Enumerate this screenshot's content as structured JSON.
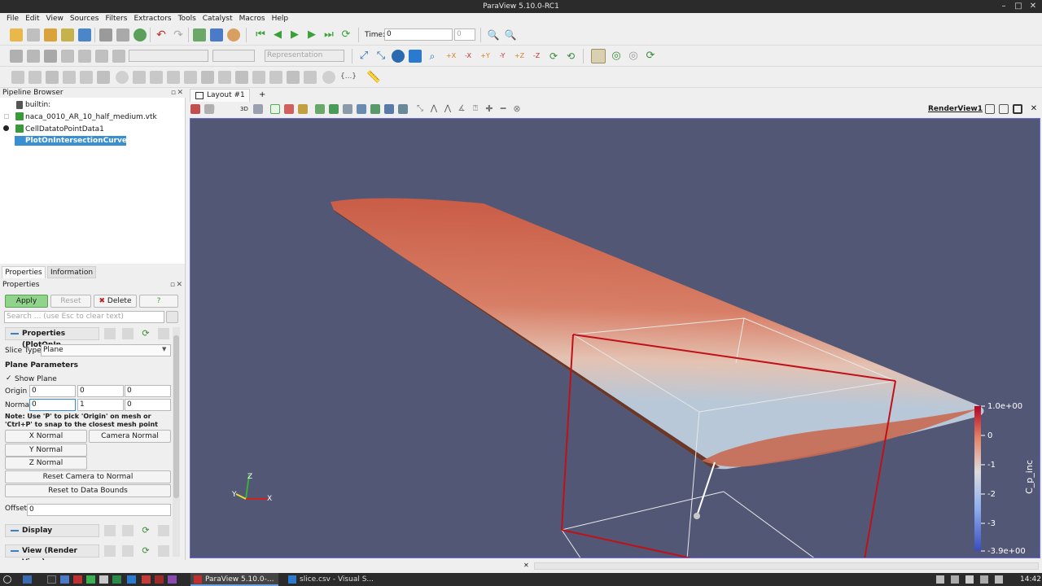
{
  "window": {
    "title": "ParaView 5.10.0-RC1"
  },
  "menu": [
    "File",
    "Edit",
    "View",
    "Sources",
    "Filters",
    "Extractors",
    "Tools",
    "Catalyst",
    "Macros",
    "Help"
  ],
  "toolbar": {
    "time_label": "Time:",
    "time_value": "0",
    "time_step": "0",
    "representation": "Representation",
    "braces": "{...}"
  },
  "pipeline": {
    "title": "Pipeline Browser",
    "items": [
      {
        "label": "builtin:"
      },
      {
        "label": "naca_0010_AR_10_half_medium.vtk"
      },
      {
        "label": "CellDatatoPointData1"
      },
      {
        "label": "PlotOnIntersectionCurves1"
      }
    ]
  },
  "tabs": {
    "properties": "Properties",
    "information": "Information"
  },
  "properties": {
    "title": "Properties",
    "apply": "Apply",
    "reset": "Reset",
    "delete": "Delete",
    "help": "?",
    "search_placeholder": "Search ... (use Esc to clear text)",
    "section_title": "Properties (PlotOnIn",
    "slice_type_label": "Slice Type",
    "slice_type_value": "Plane",
    "plane_params": "Plane Parameters",
    "show_plane": "Show Plane",
    "origin_label": "Origin",
    "origin": [
      "0",
      "0",
      "0"
    ],
    "normal_label": "Normal",
    "normal": [
      "0",
      "1",
      "0"
    ],
    "note": "Note: Use 'P' to pick 'Origin' on mesh or 'Ctrl+P' to snap to the closest mesh point",
    "x_normal": "X Normal",
    "camera_normal": "Camera Normal",
    "y_normal": "Y Normal",
    "z_normal": "Z Normal",
    "reset_camera": "Reset Camera to Normal",
    "reset_bounds": "Reset to Data Bounds",
    "offset_label": "Offset",
    "offset_value": "0",
    "display_section": "Display",
    "view_section": "View (Render View)"
  },
  "layout": {
    "tab": "Layout #1",
    "add": "+",
    "render_view": "RenderView1",
    "threed": "3D"
  },
  "colorbar": {
    "title": "C_p_inc",
    "labels": [
      "1.0e+00",
      "0",
      "-1",
      "-2",
      "-3",
      "-3.9e+00"
    ],
    "colors": {
      "top": "#b40426",
      "mid": "#dddcdc",
      "bottom": "#3b4cc0"
    }
  },
  "axes": {
    "x": "X",
    "y": "Y",
    "z": "Z"
  },
  "taskbar": {
    "apps": [
      "ParaView 5.10.0-...",
      "slice.csv - Visual S..."
    ],
    "clock": "14:42"
  },
  "colors": {
    "view_bg": "#525775",
    "selected": "#3a8fd0",
    "apply_green": "#8fd48a"
  }
}
